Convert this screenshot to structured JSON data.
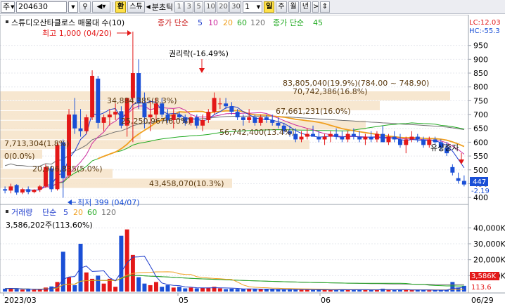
{
  "toolbar": {
    "market": "주",
    "code": "204630",
    "env_btn": "환",
    "ticker_btn": "스튜",
    "tick_label": "분초틱",
    "periods": [
      "1",
      "3",
      "5",
      "10",
      "20",
      "30"
    ],
    "interval_value": "1",
    "day_btn": "일",
    "week_btn": "주",
    "month_btn": "월",
    "year_btn": "년"
  },
  "price_panel": {
    "legend_title": "스튜디오산타클로스 매물대 수(10)",
    "legend_ma_label": "종가 단순",
    "legend_ma_periods": [
      "5",
      "10",
      "20",
      "60",
      "120"
    ],
    "legend_ma_periods_colors": [
      "#1f3dcc",
      "#cc2b9e",
      "#f0a020",
      "#22aa22",
      "#707070"
    ],
    "legend_ma2_label": "종가 단순",
    "legend_ma2_period": "45",
    "lc_label": "LC:12.03",
    "hc_label": "HC:-55.3",
    "y_ticks": [
      "950",
      "900",
      "850",
      "800",
      "750",
      "700",
      "650",
      "600",
      "550",
      "500",
      "450",
      "400"
    ],
    "current_price": "447",
    "current_change": "-2.19",
    "high_label": "최고 1,000 (04/20)",
    "low_label": "최저 399 (04/07)",
    "rights_label": "권리락(-16.49%)",
    "rights_issue_label": "유상증자",
    "volume_profile_labels": [
      "83,805,040(19.9%)(784.00 ~ 748.90)",
      "70,742,386(16.8%)",
      "34,884,385(8.3%)",
      "67,661,231(16.0%)",
      "25,250,967(6.0%)",
      "56,742,400(13.4%)",
      "7,713,304(1.8%)",
      "0(0.0%)",
      "20,906,835(5.0%)",
      "43,458,070(10.3%)"
    ]
  },
  "volume_panel": {
    "legend_title": "거래량",
    "legend_ma_label": "단순",
    "legend_ma_periods": [
      "5",
      "20",
      "60",
      "120"
    ],
    "legend_ma_periods_colors": [
      "#1f3dcc",
      "#f0a020",
      "#22aa22",
      "#707070"
    ],
    "legend_value": "3,586,202주(113.60%)",
    "y_ticks": [
      "40,000K",
      "30,000K",
      "20,000K",
      "10,000K"
    ],
    "current_volume": "3,586K",
    "current_pct": "113.6"
  },
  "x_axis": {
    "labels": [
      "2023/03",
      "05",
      "06",
      "06/29"
    ]
  },
  "chart_data": {
    "type": "candlestick",
    "symbol": "204630",
    "ylim_price": [
      380,
      1000
    ],
    "ylim_volume_k": [
      0,
      45000
    ],
    "high": {
      "date": "04/20",
      "value": 1000
    },
    "low": {
      "date": "04/07",
      "value": 399
    },
    "last": 447,
    "colors": {
      "up": "#e31818",
      "down": "#1a4fd6"
    },
    "ohlc": [
      [
        430,
        440,
        415,
        425
      ],
      [
        425,
        450,
        415,
        440
      ],
      [
        445,
        448,
        410,
        418
      ],
      [
        418,
        435,
        412,
        430
      ],
      [
        430,
        440,
        412,
        420
      ],
      [
        420,
        430,
        415,
        428
      ],
      [
        428,
        445,
        420,
        440
      ],
      [
        440,
        520,
        435,
        510
      ],
      [
        505,
        515,
        420,
        430
      ],
      [
        430,
        600,
        425,
        590
      ],
      [
        600,
        610,
        399,
        470
      ],
      [
        480,
        720,
        470,
        700
      ],
      [
        700,
        760,
        630,
        650
      ],
      [
        650,
        720,
        620,
        640
      ],
      [
        640,
        700,
        630,
        690
      ],
      [
        690,
        860,
        680,
        840
      ],
      [
        830,
        840,
        650,
        670
      ],
      [
        670,
        700,
        640,
        690
      ],
      [
        690,
        720,
        660,
        700
      ],
      [
        700,
        740,
        680,
        710
      ],
      [
        712,
        730,
        650,
        660
      ],
      [
        660,
        760,
        620,
        760
      ],
      [
        760,
        1000,
        600,
        850
      ],
      [
        850,
        900,
        720,
        740
      ],
      [
        740,
        780,
        650,
        690
      ],
      [
        690,
        750,
        640,
        700
      ],
      [
        700,
        760,
        680,
        740
      ],
      [
        740,
        760,
        690,
        700
      ],
      [
        700,
        720,
        670,
        680
      ],
      [
        680,
        720,
        650,
        700
      ],
      [
        700,
        710,
        680,
        690
      ],
      [
        690,
        700,
        660,
        670
      ],
      [
        670,
        700,
        660,
        690
      ],
      [
        690,
        700,
        650,
        660
      ],
      [
        660,
        700,
        640,
        680
      ],
      [
        680,
        720,
        670,
        710
      ],
      [
        710,
        780,
        700,
        760
      ],
      [
        740,
        760,
        720,
        740
      ],
      [
        740,
        760,
        720,
        730
      ],
      [
        730,
        745,
        700,
        710
      ],
      [
        710,
        720,
        680,
        690
      ],
      [
        690,
        700,
        660,
        680
      ],
      [
        680,
        720,
        670,
        690
      ],
      [
        690,
        700,
        660,
        670
      ],
      [
        670,
        700,
        660,
        690
      ],
      [
        690,
        700,
        670,
        680
      ],
      [
        680,
        700,
        660,
        670
      ],
      [
        670,
        690,
        650,
        660
      ],
      [
        660,
        670,
        630,
        640
      ],
      [
        640,
        660,
        620,
        630
      ],
      [
        630,
        650,
        600,
        610
      ],
      [
        610,
        640,
        600,
        620
      ],
      [
        620,
        650,
        610,
        630
      ],
      [
        630,
        660,
        620,
        620
      ],
      [
        620,
        640,
        600,
        610
      ],
      [
        610,
        630,
        590,
        620
      ],
      [
        620,
        640,
        600,
        630
      ],
      [
        630,
        650,
        610,
        620
      ],
      [
        620,
        640,
        600,
        610
      ],
      [
        610,
        640,
        600,
        630
      ],
      [
        630,
        650,
        610,
        620
      ],
      [
        620,
        640,
        600,
        610
      ],
      [
        610,
        630,
        590,
        620
      ],
      [
        620,
        640,
        600,
        610
      ],
      [
        610,
        640,
        600,
        630
      ],
      [
        630,
        660,
        610,
        600
      ],
      [
        600,
        630,
        590,
        620
      ],
      [
        620,
        640,
        600,
        610
      ],
      [
        610,
        630,
        580,
        590
      ],
      [
        590,
        620,
        560,
        610
      ],
      [
        610,
        640,
        600,
        620
      ],
      [
        620,
        630,
        600,
        610
      ],
      [
        610,
        620,
        580,
        590
      ],
      [
        590,
        620,
        580,
        610
      ],
      [
        610,
        620,
        590,
        600
      ],
      [
        600,
        610,
        570,
        580
      ],
      [
        580,
        600,
        550,
        560
      ],
      [
        510,
        520,
        480,
        490
      ],
      [
        470,
        490,
        450,
        460
      ],
      [
        460,
        480,
        440,
        447
      ]
    ],
    "volume_k": [
      1800,
      2200,
      1500,
      1200,
      1300,
      1100,
      1500,
      2500,
      3200,
      6000,
      25000,
      9000,
      4000,
      30000,
      12000,
      8000,
      10000,
      5000,
      8000,
      3000,
      35000,
      39000,
      23000,
      9000,
      5000,
      4000,
      6000,
      3000,
      4000,
      2500,
      3000,
      2000,
      2500,
      2000,
      2200,
      2500,
      3000,
      2000,
      1500,
      1800,
      1600,
      1500,
      1800,
      1500,
      1400,
      1500,
      1500,
      1300,
      1200,
      1100,
      1300,
      1200,
      1100,
      1000,
      1200,
      1100,
      1000,
      1100,
      1400,
      1000,
      1100,
      1200,
      1000,
      900,
      1100,
      1800,
      1100,
      900,
      1000,
      1200,
      900,
      1000,
      900,
      800,
      900,
      900,
      1000,
      6000,
      2500,
      3586
    ]
  }
}
